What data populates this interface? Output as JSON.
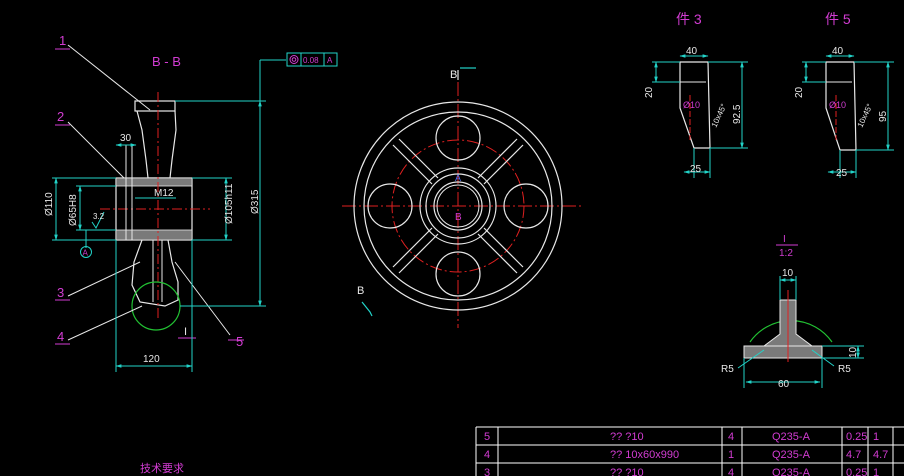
{
  "colors": {
    "background": "#000000",
    "outline": "#e8e8e8",
    "dimension": "#22d3c8",
    "center_line": "#e02020",
    "label": "#d23cd2",
    "detail_circle": "#22c233",
    "table_border": "#ffffff"
  },
  "section_view": {
    "title": "B - B",
    "callouts": [
      "1",
      "2",
      "3",
      "4",
      "5"
    ],
    "tolerance_box": {
      "value": "0.08",
      "datum": "A"
    },
    "datum_marker": "A",
    "detail_mark": "I",
    "dims": {
      "top_30": "30",
      "thread": "M12",
      "bore_dia": "Ø65H8",
      "hub_dia": "Ø110",
      "shaft_dia": "Ø105h11",
      "outer_dia": "Ø315",
      "width": "120",
      "roughness": "3.2"
    }
  },
  "front_view": {
    "section_mark_top": "B",
    "section_mark_bottom": "B",
    "center_marks": [
      "A",
      "B"
    ]
  },
  "part3": {
    "title": "件 3",
    "dims": {
      "top": "40",
      "left": "20",
      "hole": "Ø10",
      "chamfer": "10x45°",
      "height": "92.5",
      "bottom": "25"
    }
  },
  "part5": {
    "title": "件 5",
    "dims": {
      "top": "40",
      "left": "20",
      "hole": "Ø10",
      "chamfer": "10x45°",
      "height": "95",
      "bottom": "25"
    }
  },
  "detail_I": {
    "label": "I",
    "scale": "1:2",
    "dims": {
      "top": "10",
      "left_r": "R5",
      "right_r": "R5",
      "width": "60",
      "height": "10"
    }
  },
  "tech_requirements": "技术要求",
  "parts_table": {
    "rows": [
      {
        "no": "5",
        "name": "?? ?10",
        "qty": "4",
        "material": "Q235-A",
        "unit_wt": "0.25",
        "total_wt": "1"
      },
      {
        "no": "4",
        "name": "?? 10x60x990",
        "qty": "1",
        "material": "Q235-A",
        "unit_wt": "4.7",
        "total_wt": "4.7"
      },
      {
        "no": "3",
        "name": "?? ?10",
        "qty": "4",
        "material": "Q235-A",
        "unit_wt": "0.25",
        "total_wt": "1"
      }
    ]
  }
}
